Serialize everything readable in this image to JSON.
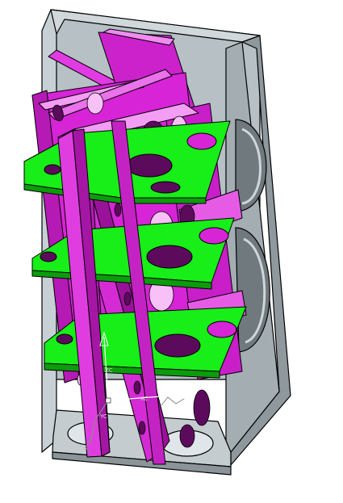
{
  "viewport": {
    "background": "#ffffff"
  },
  "colors": {
    "housing": "#a9b3b8",
    "housing_dark": "#7e888d",
    "housing_light": "#d3dade",
    "edge": "#000000",
    "tray": "#12ee12",
    "tray_dark": "#0aa50a",
    "divider": "#e62de6",
    "divider_dark": "#a014a0",
    "divider_light": "#f59af5",
    "triad": "#ffffff",
    "triad_dim": "#8a8a8a"
  },
  "triad": {
    "x_label": "XC",
    "y_label": "YC",
    "z_label": "ZC"
  }
}
